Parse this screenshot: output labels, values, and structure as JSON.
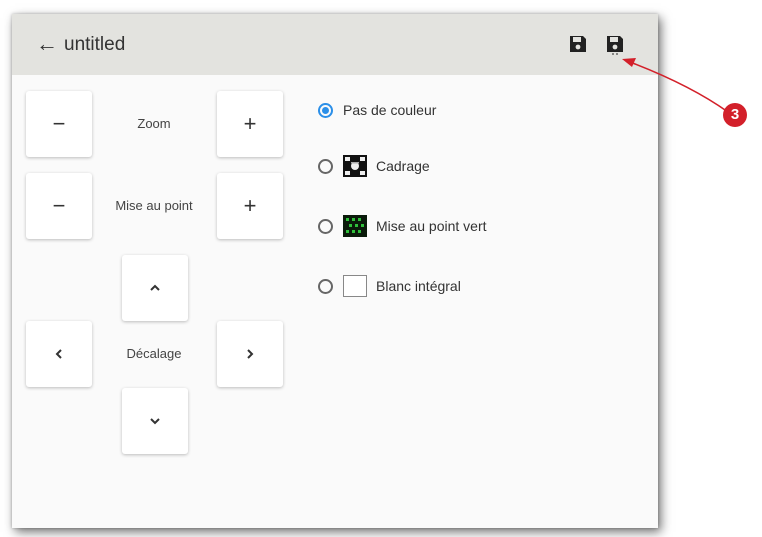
{
  "header": {
    "back_icon": "arrow-left-icon",
    "title": "untitled",
    "save_icon_1": "floppy-disk-icon",
    "save_icon_2": "floppy-disk-icon"
  },
  "controls": {
    "zoom": {
      "label": "Zoom",
      "minus": "−",
      "plus": "+"
    },
    "focus": {
      "label": "Mise au point",
      "minus": "−",
      "plus": "+"
    },
    "offset": {
      "label": "Décalage",
      "up_icon": "chevron-up-icon",
      "down_icon": "chevron-down-icon",
      "left_icon": "chevron-left-icon",
      "right_icon": "chevron-right-icon"
    }
  },
  "color_options": [
    {
      "label": "Pas de couleur",
      "selected": true
    },
    {
      "label": "Cadrage",
      "selected": false
    },
    {
      "label": "Mise au point vert",
      "selected": false
    },
    {
      "label": "Blanc intégral",
      "selected": false
    }
  ],
  "annotation": {
    "marker": "3",
    "color": "#d3202a"
  },
  "colors": {
    "accent": "#2b8fe8",
    "header_bg": "#e3e3df"
  }
}
